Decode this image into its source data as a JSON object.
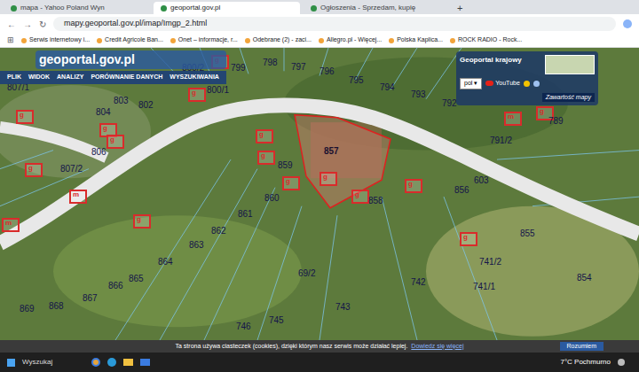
{
  "browser": {
    "tabs": [
      {
        "label": "mapa - Yahoo Poland Wyn",
        "selected": false
      },
      {
        "label": "geoportal.gov.pl",
        "selected": true
      },
      {
        "label": "Ogłoszenia - Sprzedam, kupię",
        "selected": false
      }
    ],
    "new_tab": "+",
    "address": "mapy.geoportal.gov.pl/imap/Imgp_2.html"
  },
  "bookmarks": [
    "Serwis internetowy i...",
    "Credit Agricole Ban...",
    "Onet – informacje, r...",
    "Odebrane (2) - zaci...",
    "Allegro.pl - Więcej...",
    "Polska Kaplica...",
    "ROCK RADIO - Rock..."
  ],
  "geoportal": {
    "logo": "geoportal.gov.pl",
    "menu": [
      "PLIK",
      "WIDOK",
      "ANALIZY",
      "PORÓWNANIE DANYCH",
      "WYSZUKIWANIA"
    ]
  },
  "panel": {
    "title": "Geoportal krajowy",
    "lang": "pol",
    "youtube": "YouTube",
    "contents": "Zawartość mapy"
  },
  "map": {
    "parcels": [
      {
        "label": "807/1",
        "selected": false
      },
      {
        "label": "804",
        "selected": false
      },
      {
        "label": "803",
        "selected": false
      },
      {
        "label": "802",
        "selected": false
      },
      {
        "label": "800/1",
        "selected": false
      },
      {
        "label": "800/2",
        "selected": false
      },
      {
        "label": "799",
        "selected": false
      },
      {
        "label": "798",
        "selected": false
      },
      {
        "label": "797",
        "selected": false
      },
      {
        "label": "796",
        "selected": false
      },
      {
        "label": "795",
        "selected": false
      },
      {
        "label": "794",
        "selected": false
      },
      {
        "label": "793",
        "selected": false
      },
      {
        "label": "792",
        "selected": false
      },
      {
        "label": "791/2",
        "selected": false
      },
      {
        "label": "789",
        "selected": false
      },
      {
        "label": "806",
        "selected": false
      },
      {
        "label": "807/2",
        "selected": false
      },
      {
        "label": "857",
        "selected": true
      },
      {
        "label": "859",
        "selected": false
      },
      {
        "label": "860",
        "selected": false
      },
      {
        "label": "861",
        "selected": false
      },
      {
        "label": "862",
        "selected": false
      },
      {
        "label": "863",
        "selected": false
      },
      {
        "label": "864",
        "selected": false
      },
      {
        "label": "865",
        "selected": false
      },
      {
        "label": "866",
        "selected": false
      },
      {
        "label": "867",
        "selected": false
      },
      {
        "label": "868",
        "selected": false
      },
      {
        "label": "869",
        "selected": false
      },
      {
        "label": "858",
        "selected": false
      },
      {
        "label": "856",
        "selected": false
      },
      {
        "label": "603",
        "selected": false
      },
      {
        "label": "855",
        "selected": false
      },
      {
        "label": "741/2",
        "selected": false
      },
      {
        "label": "742",
        "selected": false
      },
      {
        "label": "743",
        "selected": false
      },
      {
        "label": "745",
        "selected": false
      },
      {
        "label": "746",
        "selected": false
      },
      {
        "label": "69/2",
        "selected": false
      },
      {
        "label": "854",
        "selected": false
      },
      {
        "label": "741/1",
        "selected": false
      }
    ],
    "buildings": [
      "g",
      "g",
      "g",
      "g",
      "g",
      "g",
      "g",
      "g",
      "g",
      "g",
      "m",
      "g",
      "m",
      "g",
      "m",
      "g",
      "g",
      "g"
    ]
  },
  "cookies": {
    "text": "Ta strona używa ciasteczek (cookies), dzięki którym nasz serwis może działać lepiej.",
    "link": "Dowiedz się więcej",
    "button": "Rozumiem"
  },
  "taskbar": {
    "search": "Wyszukaj",
    "weather": "7°C Pochmurno"
  }
}
